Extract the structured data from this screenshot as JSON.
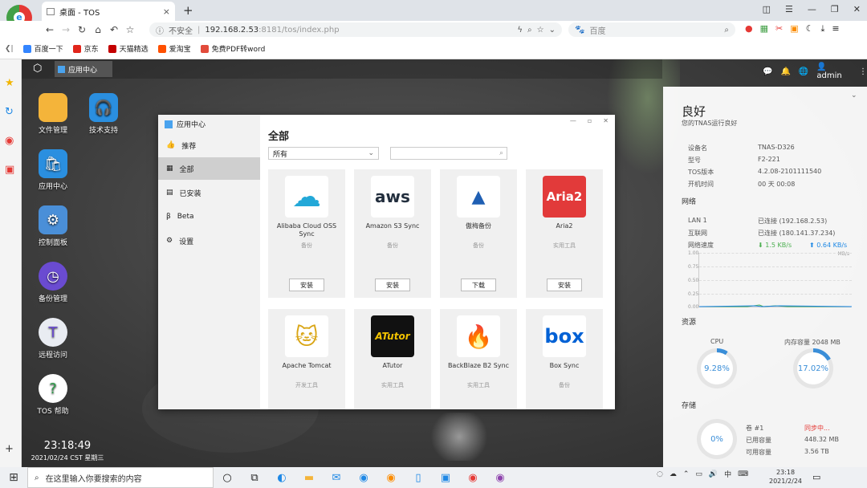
{
  "browser": {
    "tab_title": "桌面 - TOS",
    "close": "×",
    "new_tab": "+",
    "security": "不安全",
    "url_host": "192.168.2.53",
    "url_rest": ":8181/tos/index.php",
    "search_placeholder": "百度",
    "bookmarks": [
      {
        "label": "百度一下",
        "color": "#3385ff"
      },
      {
        "label": "京东",
        "color": "#e1251b"
      },
      {
        "label": "天猫精选",
        "color": "#c40000"
      },
      {
        "label": "爱淘宝",
        "color": "#ff5000"
      },
      {
        "label": "免费PDF转word",
        "color": "#e24b3b"
      }
    ]
  },
  "desktop": {
    "taskbar_app": "应用中心",
    "user": "admin",
    "icons": [
      {
        "label": "文件管理",
        "color": "#f4b43a",
        "glyph": "▬"
      },
      {
        "label": "技术支持",
        "color": "#2a8fe0",
        "glyph": "◠"
      },
      {
        "label": "应用中心",
        "color": "#2a8fe0",
        "glyph": "◫"
      },
      {
        "label": "控制面板",
        "color": "#4a8fd8",
        "glyph": "✲"
      },
      {
        "label": "备份管理",
        "color": "#6a4bd1",
        "glyph": "◷"
      },
      {
        "label": "远程访问",
        "color": "#e9ecf2",
        "glyph": "T"
      },
      {
        "label": "TOS 帮助",
        "color": "#ffffff",
        "glyph": "?"
      }
    ],
    "clock_time": "23:18:49",
    "clock_date": "2021/02/24 CST 星期三"
  },
  "app_center": {
    "title": "应用中心",
    "nav": [
      {
        "label": "推荐",
        "icon": "👍"
      },
      {
        "label": "全部",
        "icon": "▦"
      },
      {
        "label": "已安装",
        "icon": "▤"
      },
      {
        "label": "Beta",
        "icon": "β"
      },
      {
        "label": "设置",
        "icon": "⚙"
      }
    ],
    "heading": "全部",
    "filter": "所有",
    "apps": [
      {
        "name": "Alibaba Cloud OSS Sync",
        "category": "备份",
        "button": "安装",
        "logo": "☁",
        "logo_bg": "#ffffff",
        "logo_color": "#23a8d8"
      },
      {
        "name": "Amazon S3 Sync",
        "category": "备份",
        "button": "安装",
        "logo": "aws",
        "logo_bg": "#ffffff",
        "logo_color": "#232f3e"
      },
      {
        "name": "傲梅备份",
        "category": "备份",
        "button": "下载",
        "logo": "▲",
        "logo_bg": "#ffffff",
        "logo_color": "#1f5fb3"
      },
      {
        "name": "Aria2",
        "category": "实用工具",
        "button": "安装",
        "logo": "Aria2",
        "logo_bg": "#e23a3a",
        "logo_color": "#ffffff"
      },
      {
        "name": "Apache Tomcat",
        "category": "开发工具",
        "button": "",
        "logo": "🐱",
        "logo_bg": "#ffffff",
        "logo_color": "#d9a514"
      },
      {
        "name": "ATutor",
        "category": "实用工具",
        "button": "",
        "logo": "ATutor",
        "logo_bg": "#111111",
        "logo_color": "#f2c200"
      },
      {
        "name": "BackBlaze B2 Sync",
        "category": "实用工具",
        "button": "",
        "logo": "🔥",
        "logo_bg": "#ffffff",
        "logo_color": "#c8102e"
      },
      {
        "name": "Box Sync",
        "category": "备份",
        "button": "",
        "logo": "box",
        "logo_bg": "#ffffff",
        "logo_color": "#0061d5"
      }
    ]
  },
  "status": {
    "health": "良好",
    "subtitle": "您的TNAS运行良好",
    "device_name_label": "设备名",
    "device_name": "TNAS-D326",
    "model_label": "型号",
    "model": "F2-221",
    "tos_label": "TOS版本",
    "tos": "4.2.08-2101111540",
    "uptime_label": "开机时间",
    "uptime": "00 天 00:08",
    "network_title": "网络",
    "lan_label": "LAN 1",
    "lan": "已连接 (192.168.2.53)",
    "wan_label": "互联网",
    "wan": "已连接 (180.141.37.234)",
    "speed_label": "网络速度",
    "down": "1.5 KB/s",
    "up": "0.64 KB/s",
    "graph_unit": "MB/s",
    "graph_ticks": [
      "1.00",
      "0.75",
      "0.50",
      "0.25",
      "0.00"
    ],
    "resource_title": "资源",
    "cpu_label": "CPU",
    "cpu": "9.28%",
    "cpu_fraction": 0.0928,
    "mem_label": "内存容量 2048 MB",
    "mem": "17.02%",
    "mem_fraction": 0.1702,
    "storage_title": "存储",
    "vol_label": "卷 #1",
    "vol_status": "同步中...",
    "used_label": "已用容量",
    "used": "448.32 MB",
    "avail_label": "可用容量",
    "avail": "3.56 TB",
    "storage_pct": "0%"
  },
  "taskbar": {
    "search": "在这里输入你要搜索的内容",
    "time": "23:18",
    "date": "2021/2/24"
  }
}
